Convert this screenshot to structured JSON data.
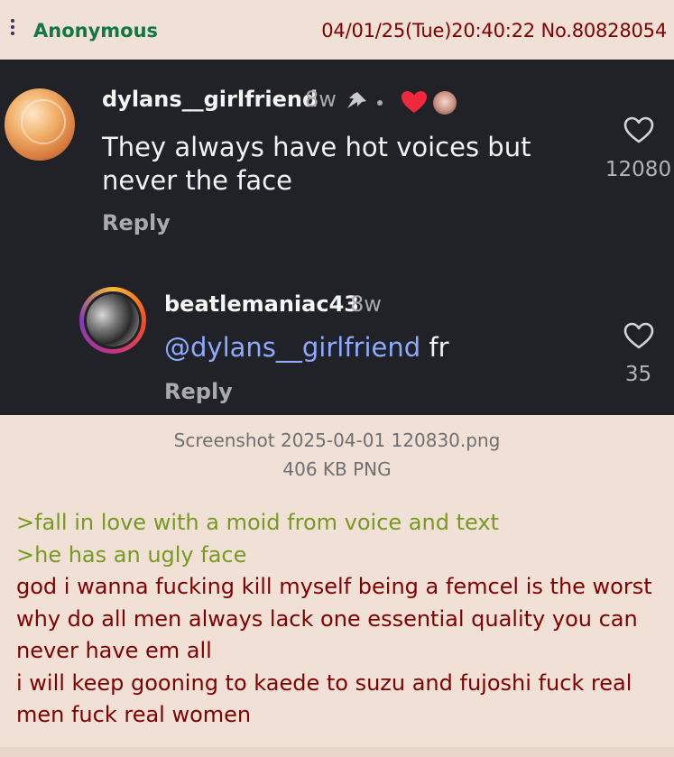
{
  "post": {
    "name": "Anonymous",
    "date": "04/01/25(Tue)20:40:22",
    "number": "No.80828054",
    "file": {
      "name": "Screenshot 2025-04-01 120830.png",
      "size": "406 KB PNG"
    },
    "greentext": [
      ">fall in love with a moid from voice and text",
      ">he has an ugly face"
    ],
    "body": [
      "god i wanna fucking kill myself being a femcel is the worst why do all men always lack one essential quality you can never have em all",
      "i will keep gooning to kaede to suzu and fujoshi fuck real men fuck real women"
    ]
  },
  "screenshot": {
    "comment1": {
      "username": "dylans__girlfriend",
      "time": "8w",
      "text": "They always have hot voices but never the face",
      "reply": "Reply",
      "likes": "12080"
    },
    "comment2": {
      "username": "beatlemaniac43",
      "time": "8w",
      "mention": "@dylans__girlfriend",
      "text": " fr",
      "reply": "Reply",
      "likes": "35"
    }
  },
  "colors": {
    "post_bg": "#f0e0d6",
    "name": "#117743",
    "meta": "#800000",
    "greentext": "#789922",
    "screenshot_bg": "#202227"
  },
  "icons": [
    "menu-dots-icon",
    "pin-icon",
    "heart-filled-icon",
    "heart-outline-icon"
  ]
}
